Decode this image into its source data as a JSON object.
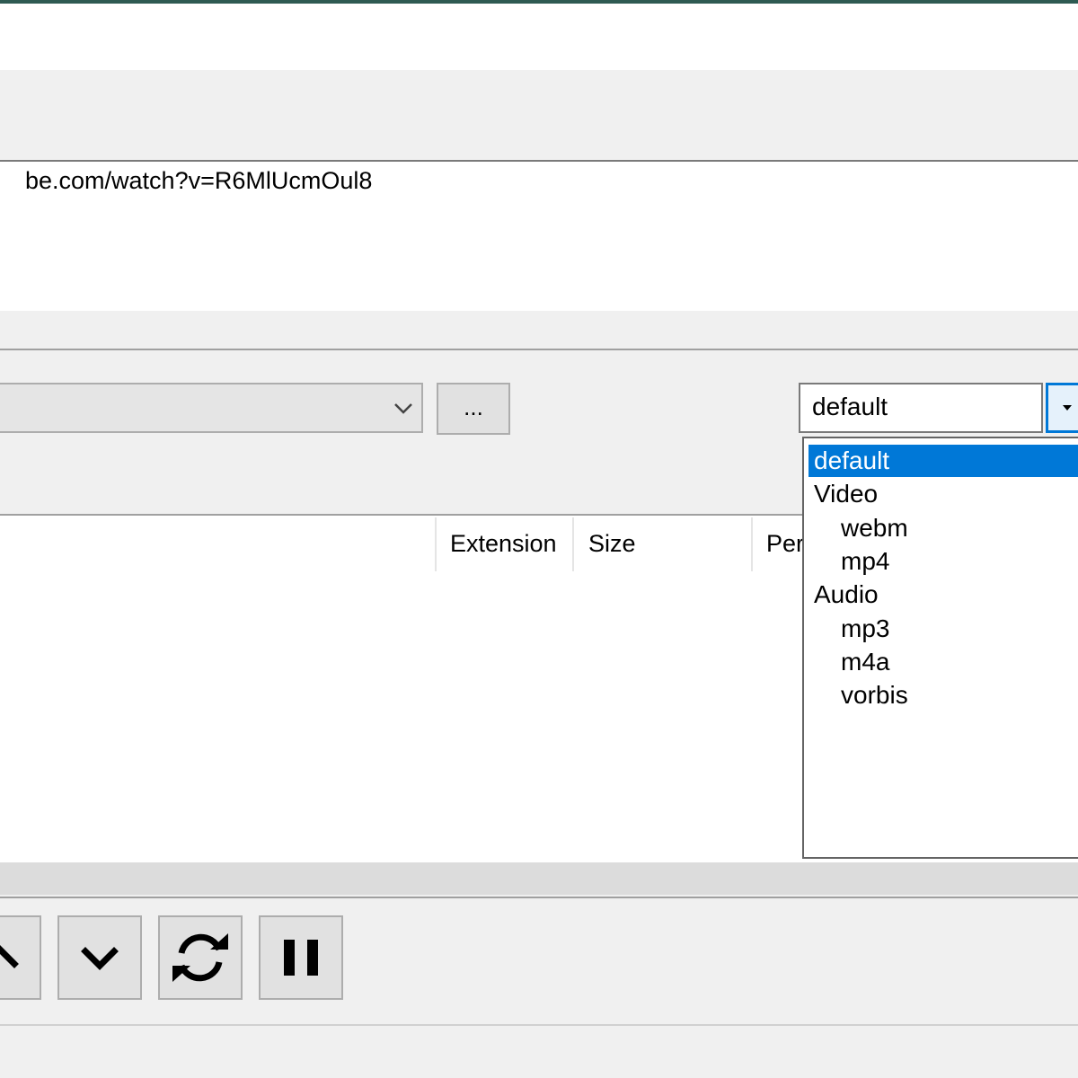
{
  "url_input": {
    "value": "be.com/watch?v=R6MlUcmOul8"
  },
  "path_select": {
    "value": ""
  },
  "browse_button": {
    "label": "..."
  },
  "format_select": {
    "value": "default",
    "options": [
      {
        "label": "default",
        "selected": true,
        "indent": false
      },
      {
        "label": "Video",
        "selected": false,
        "indent": false
      },
      {
        "label": "webm",
        "selected": false,
        "indent": true
      },
      {
        "label": "mp4",
        "selected": false,
        "indent": true
      },
      {
        "label": "Audio",
        "selected": false,
        "indent": false
      },
      {
        "label": "mp3",
        "selected": false,
        "indent": true
      },
      {
        "label": "m4a",
        "selected": false,
        "indent": true
      },
      {
        "label": "vorbis",
        "selected": false,
        "indent": true
      }
    ]
  },
  "table": {
    "columns": [
      "Extension",
      "Size",
      "Per"
    ]
  },
  "toolbar": {
    "buttons": [
      {
        "icon": "chevron-up-icon"
      },
      {
        "icon": "chevron-down-icon"
      },
      {
        "icon": "refresh-icon"
      },
      {
        "icon": "pause-icon"
      }
    ]
  },
  "colors": {
    "accent": "#0078d7",
    "selection_text": "#ffffff",
    "window_bg": "#f0f0f0"
  }
}
